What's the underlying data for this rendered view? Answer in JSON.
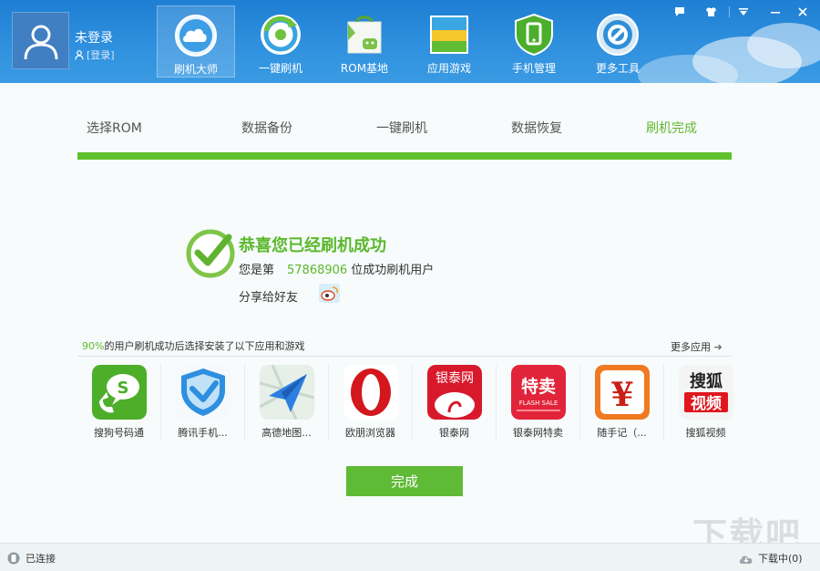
{
  "user": {
    "name": "未登录",
    "login_link": "[登录]"
  },
  "nav": {
    "items": [
      {
        "label": "刷机大师",
        "icon": "cloud-icon",
        "active": true
      },
      {
        "label": "一键刷机",
        "icon": "refresh-cycle-icon"
      },
      {
        "label": "ROM基地",
        "icon": "android-bag-icon"
      },
      {
        "label": "应用游戏",
        "icon": "app-box-icon"
      },
      {
        "label": "手机管理",
        "icon": "phone-shield-icon"
      },
      {
        "label": "更多工具",
        "icon": "wrench-gear-icon"
      }
    ]
  },
  "window_controls": [
    "message-icon",
    "skin-icon",
    "menu-icon",
    "minimize-icon",
    "close-icon"
  ],
  "steps": [
    {
      "label": "选择ROM",
      "done": false
    },
    {
      "label": "数据备份",
      "done": false
    },
    {
      "label": "一键刷机",
      "done": false
    },
    {
      "label": "数据恢复",
      "done": false
    },
    {
      "label": "刷机完成",
      "done": true
    }
  ],
  "progress": 1.0,
  "success": {
    "title": "恭喜您已经刷机成功",
    "rank_prefix": "您是第",
    "rank_number": "57868906",
    "rank_suffix": "位成功刷机用户",
    "share_label": "分享给好友"
  },
  "apps_section": {
    "percent": "90%",
    "header_text": "的用户刷机成功后选择安装了以下应用和游戏",
    "more_label": "更多应用",
    "apps": [
      {
        "name": "搜狗号码通",
        "icon": "sogou-phone-icon"
      },
      {
        "name": "腾讯手机...",
        "icon": "tencent-shield-icon"
      },
      {
        "name": "高德地图...",
        "icon": "amap-plane-icon"
      },
      {
        "name": "欧朋浏览器",
        "icon": "opera-icon"
      },
      {
        "name": "银泰网",
        "icon": "yintai-icon"
      },
      {
        "name": "银泰网特卖",
        "icon": "yintai-flash-sale-icon"
      },
      {
        "name": "随手记（...",
        "icon": "yen-icon"
      },
      {
        "name": "搜狐视频",
        "icon": "sohu-video-icon"
      }
    ]
  },
  "finish_label": "完成",
  "status": {
    "connection": "已连接",
    "download": "下载中(0)"
  },
  "watermark": "下载吧",
  "colors": {
    "header": "#2f90de",
    "accent_green": "#5fbb36"
  }
}
